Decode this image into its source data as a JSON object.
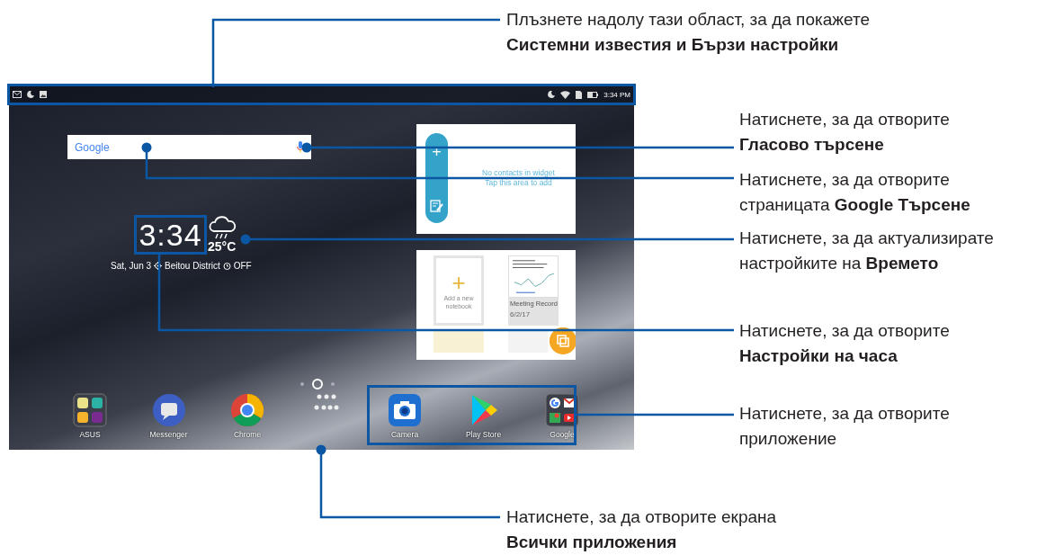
{
  "status_bar": {
    "time": "3:34 PM"
  },
  "search_widget": {
    "logo": "Google"
  },
  "contacts_widget": {
    "message": "No contacts in widget",
    "hint": "Tap this area to add",
    "add_icon": "+"
  },
  "clock_widget": {
    "time": "3:34",
    "temperature": "25°C",
    "date": "Sat, Jun 3",
    "location": "Beitou District",
    "alarm": "OFF"
  },
  "notebook_widget": {
    "add_label": "Add a new notebook",
    "add_icon": "+",
    "note_title": "Meeting Record",
    "note_date": "6/2/17"
  },
  "pages": [
    {
      "selected": false
    },
    {
      "selected": true
    },
    {
      "selected": false
    }
  ],
  "dock": [
    {
      "label": "ASUS",
      "kind": "folder"
    },
    {
      "label": "Messenger",
      "kind": "messenger"
    },
    {
      "label": "Chrome",
      "kind": "chrome"
    },
    {
      "kind": "all_apps"
    },
    {
      "label": "Camera",
      "kind": "camera"
    },
    {
      "label": "Play Store",
      "kind": "play"
    },
    {
      "label": "Google",
      "kind": "gfolder"
    }
  ],
  "callouts": [
    {
      "kind": "status",
      "lines": [
        "Плъзнете надолу тази област, за да покажете",
        "**Системни известия и Бързи настройки**"
      ]
    },
    {
      "kind": "voice",
      "lines": [
        "Натиснете, за да отворите",
        "**Гласово търсене**"
      ]
    },
    {
      "kind": "search",
      "lines": [
        "Натиснете, за да отворите",
        "страницата **Google Търсене**"
      ]
    },
    {
      "kind": "weather",
      "lines": [
        "Натиснете, за да актуализирате",
        "настройките на **Времето**"
      ]
    },
    {
      "kind": "clock",
      "lines": [
        "Натиснете, за да отворите",
        "**Настройки на часа**"
      ]
    },
    {
      "kind": "apps",
      "lines": [
        "Натиснете, за да отворите",
        "приложение"
      ]
    },
    {
      "kind": "allapps",
      "lines": [
        "Натиснете, за да отворите екрана",
        "**Всички приложения**"
      ]
    }
  ]
}
